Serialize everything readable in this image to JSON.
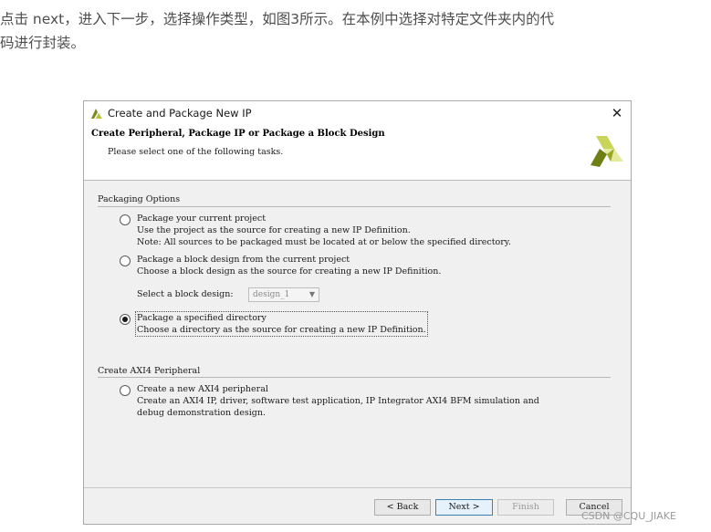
{
  "article": {
    "line1": "点击 next，进入下一步，选择操作类型，如图3所示。在本例中选择对特定文件夹内的代",
    "line2": "码进行封装。"
  },
  "dialog": {
    "title": "Create and Package New IP",
    "close_label": "✕",
    "header": {
      "title": "Create Peripheral, Package IP or Package a Block Design",
      "subtitle": "Please select one of the following tasks."
    },
    "packaging_section": {
      "label": "Packaging Options",
      "options": [
        {
          "title": "Package your current project",
          "desc1": "Use the project as the source for creating a new IP Definition.",
          "desc2": "Note: All sources to be packaged must be located at or below the specified directory.",
          "checked": false
        },
        {
          "title": "Package a block design from the current project",
          "desc1": "Choose a block design as the source for creating a new IP Definition.",
          "checked": false
        },
        {
          "title": "Package a specified directory",
          "desc1": "Choose a directory as the source for creating a new IP Definition.",
          "checked": true
        }
      ],
      "block_design_label": "Select a block design:",
      "block_design_value": "design_1"
    },
    "axi_section": {
      "label": "Create AXI4 Peripheral",
      "option": {
        "title": "Create a new AXI4 peripheral",
        "desc1": "Create an AXI4 IP, driver, software test application, IP Integrator AXI4 BFM simulation and",
        "desc2": "debug demonstration design.",
        "checked": false
      }
    },
    "buttons": {
      "back": "< Back",
      "next": "Next >",
      "finish": "Finish",
      "cancel": "Cancel"
    }
  },
  "watermark": "CSDN @CQU_JIAKE",
  "colors": {
    "xilinx_logo": "#b5c234",
    "primary_button_border": "#3c7fb1"
  }
}
